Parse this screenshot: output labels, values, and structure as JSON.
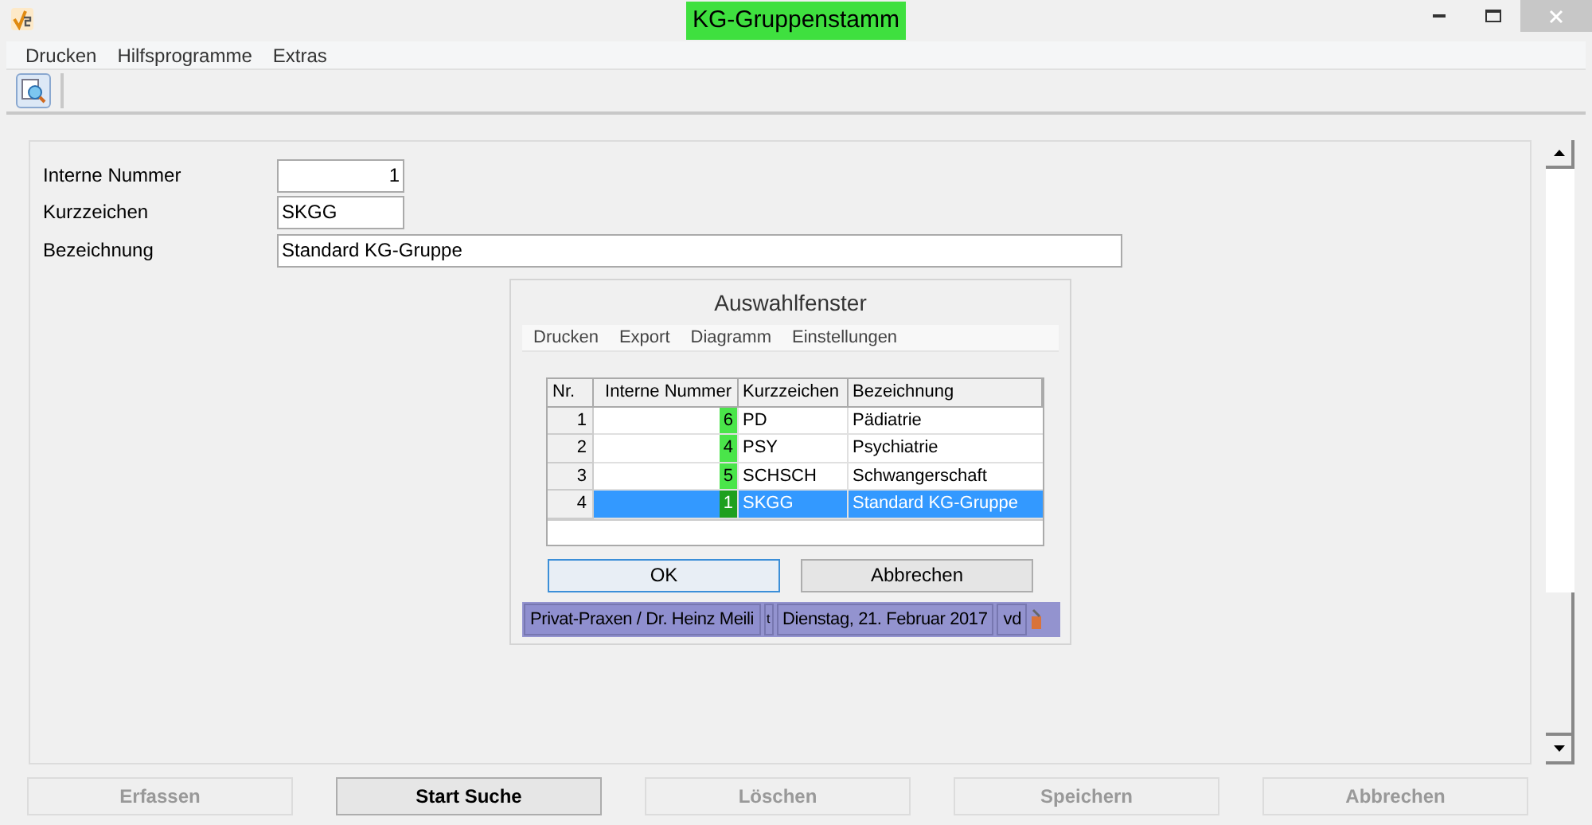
{
  "window": {
    "title": "KG-Gruppenstamm",
    "title_highlighted": true
  },
  "menu": [
    "Drucken",
    "Hilfsprogramme",
    "Extras"
  ],
  "form": {
    "fields": [
      {
        "label": "Interne Nummer",
        "value": "1",
        "kind": "number"
      },
      {
        "label": "Kurzzeichen",
        "value": "SKGG",
        "kind": "short"
      },
      {
        "label": "Bezeichnung",
        "value": "Standard KG-Gruppe",
        "kind": "long"
      }
    ]
  },
  "dialog": {
    "title": "Auswahlfenster",
    "menu": [
      "Drucken",
      "Export",
      "Diagramm",
      "Einstellungen"
    ],
    "table": {
      "columns": [
        "Nr.",
        "Interne Nummer",
        "Kurzzeichen",
        "Bezeichnung"
      ],
      "rows": [
        {
          "nr": "1",
          "number": "6",
          "code": "PD",
          "name": "Pädiatrie",
          "highlighted": true,
          "selected": false
        },
        {
          "nr": "2",
          "number": "4",
          "code": "PSY",
          "name": "Psychiatrie",
          "highlighted": true,
          "selected": false
        },
        {
          "nr": "3",
          "number": "5",
          "code": "SCHSCH",
          "name": "Schwangerschaft",
          "highlighted": true,
          "selected": false
        },
        {
          "nr": "4",
          "number": "1",
          "code": "SKGG",
          "name": "Standard KG-Gruppe",
          "highlighted": true,
          "selected": true
        }
      ]
    },
    "buttons": [
      {
        "label": "OK",
        "default": true
      },
      {
        "label": "Abbrechen",
        "default": false
      }
    ],
    "status_bar": {
      "user": "Privat-Praxen / Dr. Heinz Meili",
      "marker": "t",
      "date": "Dienstag, 21. Februar 2017",
      "initials": "vd"
    }
  },
  "buttons": [
    {
      "label": "Erfassen",
      "disabled": true
    },
    {
      "label": "Start Suche",
      "disabled": false
    },
    {
      "label": "Löschen",
      "disabled": true
    },
    {
      "label": "Speichern",
      "disabled": true
    },
    {
      "label": "Abbrechen",
      "disabled": true
    }
  ]
}
